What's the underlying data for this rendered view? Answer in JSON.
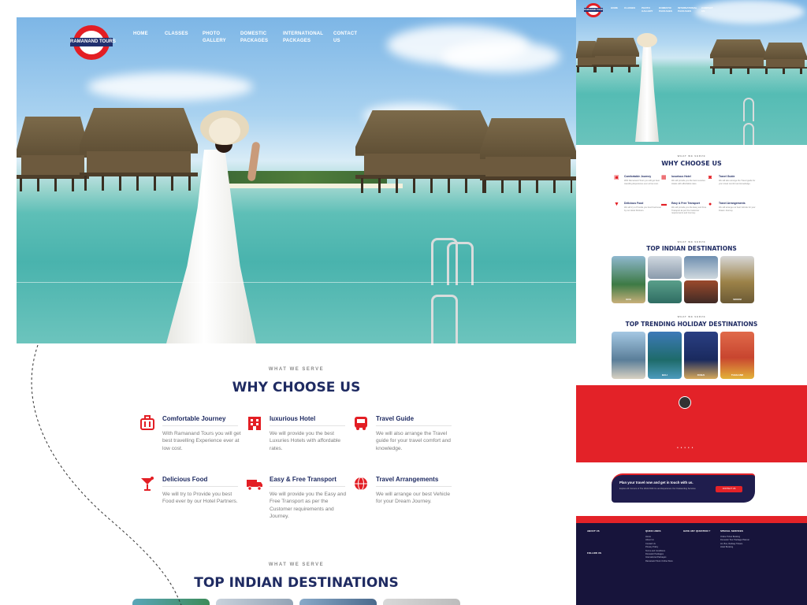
{
  "brand": {
    "logo_text": "RAMANAND TOURS",
    "accent": "#e31e24",
    "navy": "#1f2b62"
  },
  "nav": {
    "items": [
      {
        "label": "HOME"
      },
      {
        "label": "CLASSES"
      },
      {
        "label": "PHOTO GALLERY"
      },
      {
        "label": "DOMESTIC PACKAGES"
      },
      {
        "label": "INTERNATIONAL PACKAGES"
      },
      {
        "label": "CONTACT US"
      }
    ]
  },
  "why": {
    "eyebrow": "WHAT WE SERVE",
    "title": "WHY CHOOSE US",
    "features": [
      {
        "icon": "luggage-icon",
        "title": "Comfortable Journey",
        "text": "With Ramanand Tours you will get best travelling Experience ever at low cost."
      },
      {
        "icon": "hotel-icon",
        "title": "luxurious Hotel",
        "text": "We will provide you the best Luxuries Hotels with affordable rates."
      },
      {
        "icon": "bus-icon",
        "title": "Travel Guide",
        "text": "We will also arrange the Travel guide for your travel comfort and knowledge."
      },
      {
        "icon": "cocktail-icon",
        "title": "Delicious Food",
        "text": "We will try to Provide you best Food ever by our Hotel Partners."
      },
      {
        "icon": "truck-icon",
        "title": "Easy & Free Transport",
        "text": "We will provide you the Easy and Free Transport as per the Customer requirements and Journey."
      },
      {
        "icon": "globe-icon",
        "title": "Travel Arrangements",
        "text": "We will arrange our best Vehicle for your Dream Journey."
      }
    ]
  },
  "destinations": {
    "eyebrow": "WHAT WE SERVE",
    "title": "TOP INDIAN DESTINATIONS",
    "preview_items": [
      "GOA",
      "",
      "",
      "SIKKIM",
      "",
      "",
      "",
      ""
    ]
  },
  "trending": {
    "eyebrow": "WHAT WE SERVE",
    "title": "TOP TRENDING HOLIDAY DESTINATIONS",
    "items": [
      "",
      "BALI",
      "DUBAI",
      "THAILAND"
    ]
  },
  "cta": {
    "title": "Plan your travel now and get in touch with us.",
    "subtitle": "Explore All Corners of The World With Us and Experience Our Outstanding Services",
    "button": "CONTACT US"
  },
  "footer": {
    "about_title": "ABOUT US",
    "quick_title": "QUICK LINKS",
    "question_title": "HAVE ANY QUESTION ?",
    "special_title": "SPECIAL SERVICES",
    "follow_title": "FOLLOW US",
    "quick_links": [
      "Home",
      "About Us",
      "Contact Us",
      "Privacy Policy",
      "Terms and Conditions",
      "Domestic Packages",
      "International Packages",
      "Ramanand Tours Online Store"
    ],
    "special_services": [
      "Online Ticket Booking",
      "Domestic Tour Package Planner",
      "Air, Bus, Railway Tickets",
      "Hotel Booking"
    ]
  }
}
